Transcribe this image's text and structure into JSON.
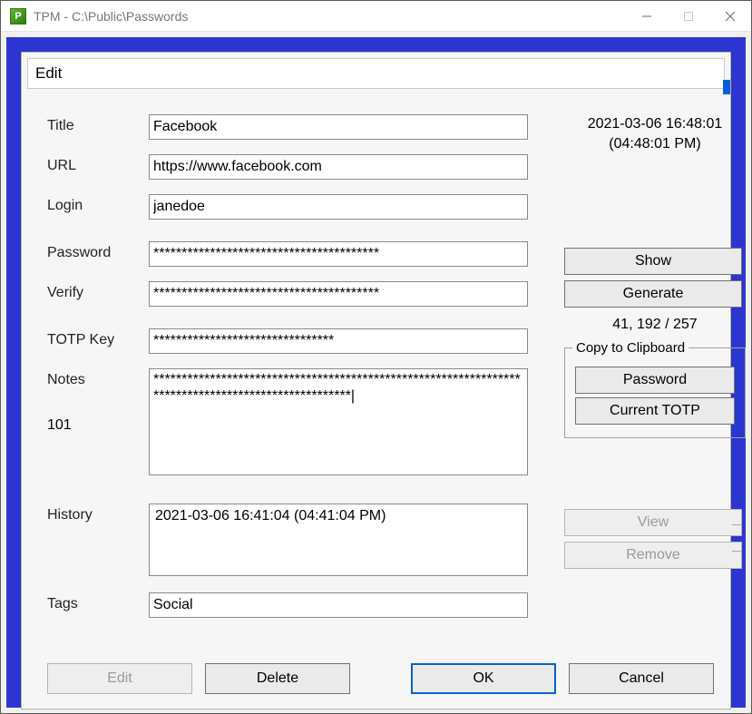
{
  "window": {
    "title": "TPM - C:\\Public\\Passwords",
    "icon_letter": "P"
  },
  "dialog": {
    "title": "Edit"
  },
  "timestamp": {
    "line1": "2021-03-06 16:48:01",
    "line2": "(04:48:01 PM)"
  },
  "labels": {
    "title": "Title",
    "url": "URL",
    "login": "Login",
    "password": "Password",
    "verify": "Verify",
    "totp": "TOTP Key",
    "notes": "Notes",
    "notes_count": "101",
    "history": "History",
    "tags": "Tags"
  },
  "fields": {
    "title": "Facebook",
    "url": "https://www.facebook.com",
    "login": "janedoe",
    "password": "****************************************",
    "verify": "****************************************",
    "totp": "********************************",
    "notes": "****************************************************************************************************|",
    "tags": "Social"
  },
  "history": {
    "items": [
      "2021-03-06 16:41:04 (04:41:04 PM)"
    ]
  },
  "buttons": {
    "show": "Show",
    "generate": "Generate",
    "copy_password": "Password",
    "copy_totp": "Current TOTP",
    "view": "View",
    "remove": "Remove",
    "edit": "Edit",
    "delete": "Delete",
    "ok": "OK",
    "cancel": "Cancel"
  },
  "groups": {
    "clipboard": "Copy to Clipboard"
  },
  "stats": "41, 192 / 257"
}
